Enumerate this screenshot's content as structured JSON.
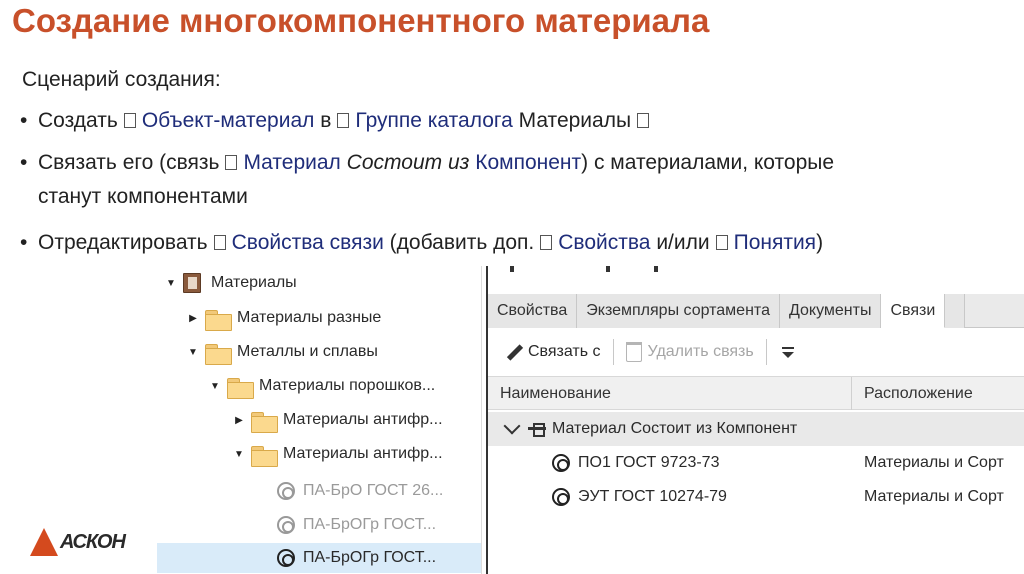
{
  "title": "Создание многокомпонентного материала",
  "scenario_label": "Сценарий создания:",
  "bullets": {
    "b1": {
      "p1": "Создать",
      "p2": "Объект-материал",
      "p3": "в",
      "p4": "Группе каталога",
      "p5": "Материалы"
    },
    "b2": {
      "p1": "Связать его (связь",
      "p2": "Материал",
      "p3": "Состоит из",
      "p4": "Компонент",
      "p5": ") с материалами, которые",
      "p6": "станут компонентами"
    },
    "b3": {
      "p1": "Отредактировать",
      "p2": "Свойства связи",
      "p3": "(добавить доп.",
      "p4": "Свойства",
      "p5": "и/или",
      "p6": "Понятия",
      "p7": ")"
    }
  },
  "tree": {
    "items": [
      {
        "label": "Материалы"
      },
      {
        "label": "Материалы разные"
      },
      {
        "label": "Металлы и сплавы"
      },
      {
        "label": "Материалы порошков..."
      },
      {
        "label": "Материалы антифр..."
      },
      {
        "label": "Материалы антифр..."
      },
      {
        "label": "ПА-БрО ГОСТ 26..."
      },
      {
        "label": "ПА-БрОГр ГОСТ..."
      },
      {
        "label": "ПА-БрОГр ГОСТ..."
      }
    ]
  },
  "panel": {
    "tabs": [
      "Свойства",
      "Экземпляры сортамента",
      "Документы",
      "Связи"
    ],
    "toolbar": {
      "link": "Связать с",
      "unlink": "Удалить связь"
    },
    "columns": {
      "name": "Наименование",
      "location": "Расположение"
    },
    "group": "Материал Состоит из Компонент",
    "rows": [
      {
        "name": "ПО1 ГОСТ 9723-73",
        "location": "Материалы и Сорт"
      },
      {
        "name": "ЭУТ ГОСТ 10274-79",
        "location": "Материалы и Сорт"
      }
    ]
  },
  "logo": {
    "text": "АСКОН"
  },
  "colors": {
    "title": "#c8502a",
    "highlight": "#1f2d7a",
    "selection": "#d9ebf9",
    "logo": "#d44a1e"
  }
}
